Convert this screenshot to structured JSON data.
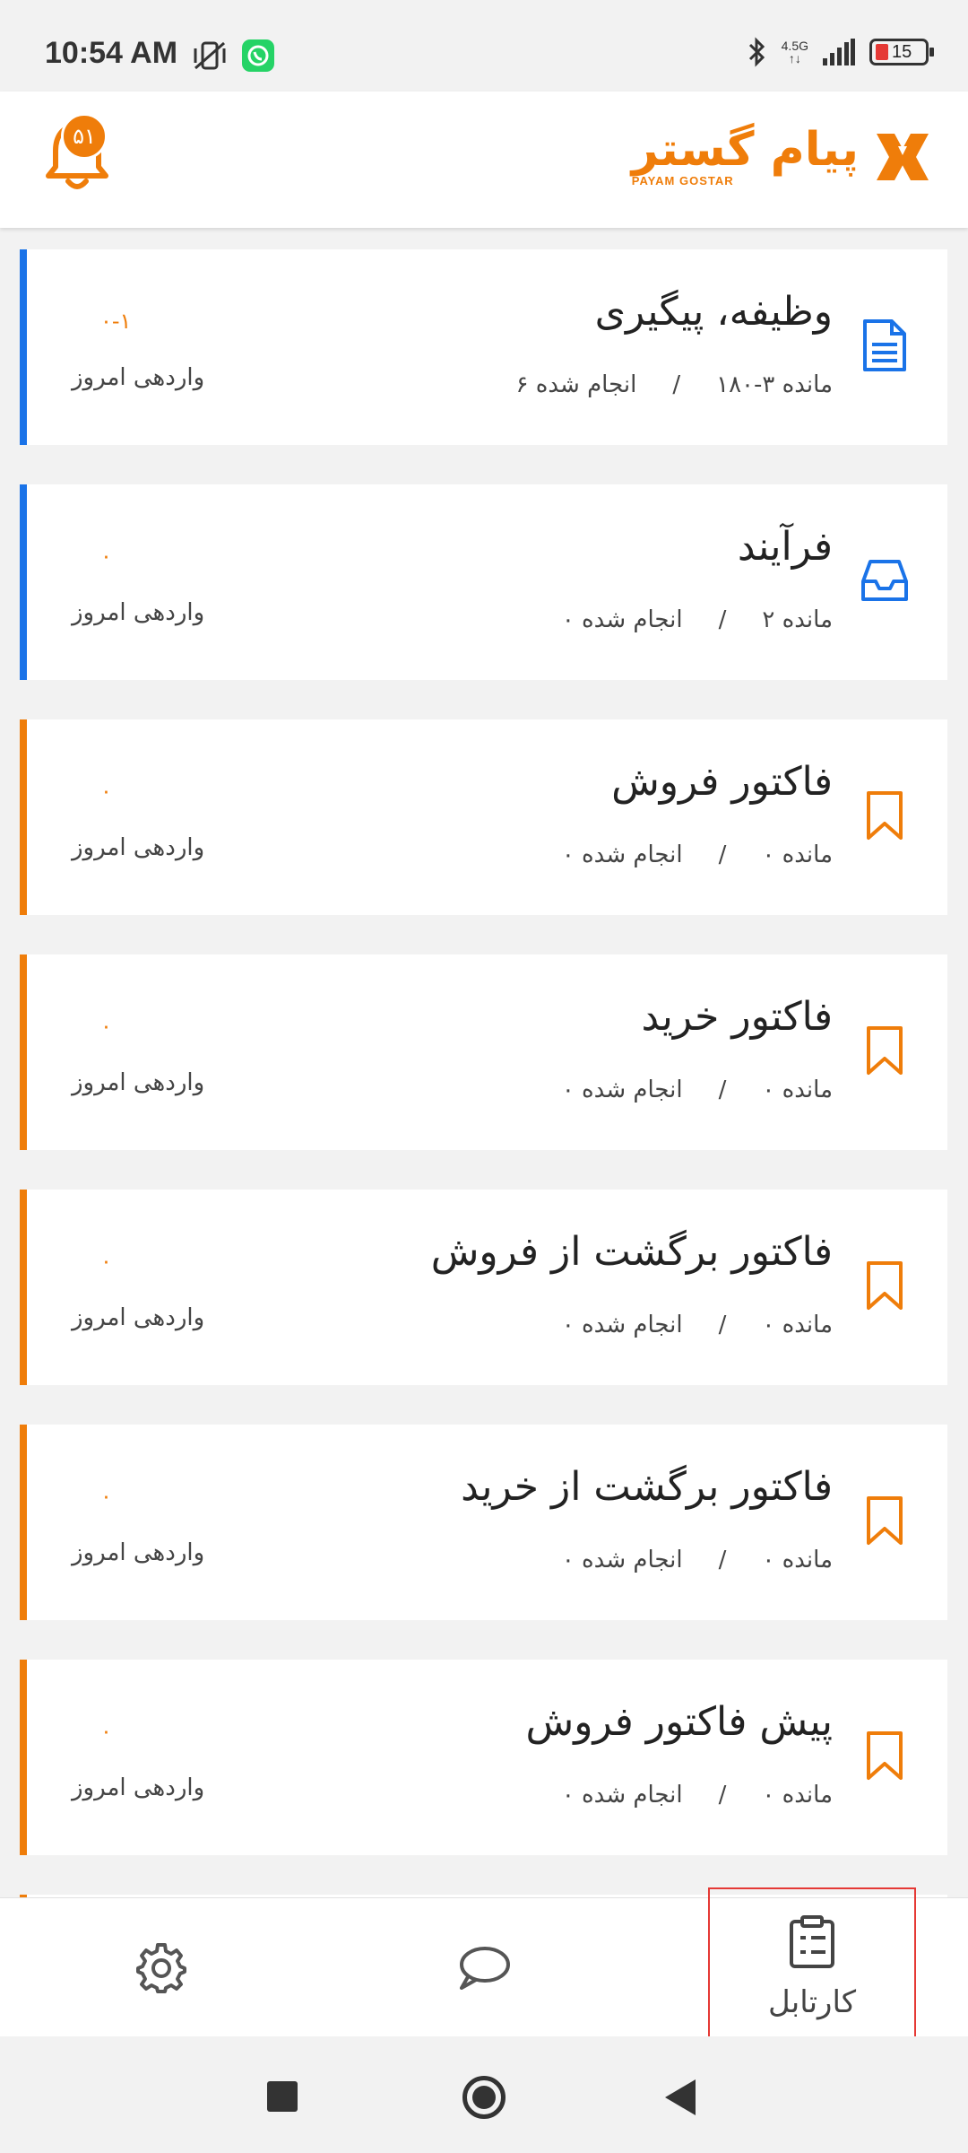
{
  "status_bar": {
    "time": "10:54 AM",
    "network_label_top": "4.5G",
    "network_label_bottom": "↑↓",
    "battery_level": "15"
  },
  "header": {
    "logo_text": "پیام گستر",
    "logo_subtext": "PAYAM GOSTAR",
    "notification_count": "۵۱"
  },
  "cards": [
    {
      "title": "وظیفه، پیگیری",
      "remaining": "مانده ۳-۱۸۰",
      "separator": "/",
      "done": "انجام شده ۶",
      "count": "۰-۱",
      "today_label": "واردهی امروز",
      "icon": "document-icon",
      "accent": "#1a73e8"
    },
    {
      "title": "فرآیند",
      "remaining": "مانده ۲",
      "separator": "/",
      "done": "انجام شده ۰",
      "count": "۰",
      "today_label": "واردهی امروز",
      "icon": "inbox-icon",
      "accent": "#1a73e8"
    },
    {
      "title": "فاکتور فروش",
      "remaining": "مانده ۰",
      "separator": "/",
      "done": "انجام شده ۰",
      "count": "۰",
      "today_label": "واردهی امروز",
      "icon": "bookmark-icon",
      "accent": "#ef7d0a"
    },
    {
      "title": "فاکتور خرید",
      "remaining": "مانده ۰",
      "separator": "/",
      "done": "انجام شده ۰",
      "count": "۰",
      "today_label": "واردهی امروز",
      "icon": "bookmark-icon",
      "accent": "#ef7d0a"
    },
    {
      "title": "فاکتور برگشت از فروش",
      "remaining": "مانده ۰",
      "separator": "/",
      "done": "انجام شده ۰",
      "count": "۰",
      "today_label": "واردهی امروز",
      "icon": "bookmark-icon",
      "accent": "#ef7d0a"
    },
    {
      "title": "فاکتور برگشت از خرید",
      "remaining": "مانده ۰",
      "separator": "/",
      "done": "انجام شده ۰",
      "count": "۰",
      "today_label": "واردهی امروز",
      "icon": "bookmark-icon",
      "accent": "#ef7d0a"
    },
    {
      "title": "پیش فاکتور فروش",
      "remaining": "مانده ۰",
      "separator": "/",
      "done": "انجام شده ۰",
      "count": "۰",
      "today_label": "واردهی امروز",
      "icon": "bookmark-icon",
      "accent": "#ef7d0a"
    }
  ],
  "bottom_nav": {
    "cartable_label": "کارتابل",
    "settings_icon": "gear-icon",
    "chat_icon": "chat-bubble-icon",
    "cartable_icon": "clipboard-icon"
  },
  "colors": {
    "brand_orange": "#ef7d0a",
    "accent_blue": "#1a73e8",
    "highlight_red": "#e53935"
  }
}
